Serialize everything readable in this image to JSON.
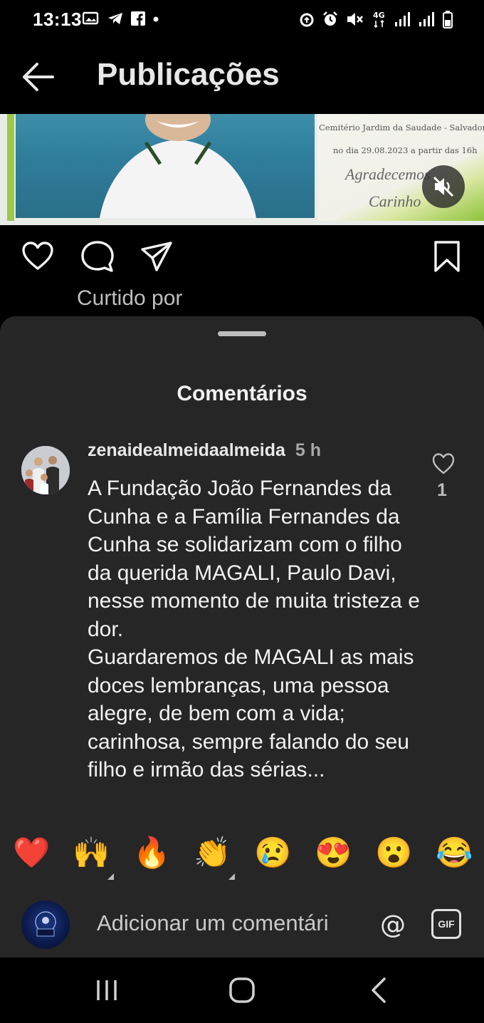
{
  "status_bar": {
    "time": "13:13",
    "left_icons": [
      "image-notification-icon",
      "telegram-icon",
      "facebook-icon",
      "dot-icon"
    ],
    "network_label": "4G",
    "right_icons": [
      "data-saver-icon",
      "alarm-icon",
      "mute-icon",
      "4g-icon",
      "signal-icon",
      "signal-icon",
      "battery-icon"
    ]
  },
  "header": {
    "title": "Publicações",
    "back_icon": "arrow-left-icon"
  },
  "post": {
    "caption_line1": "Cemitério Jardim da Saudade - Salvador",
    "caption_line2": "no dia 29.08.2023 a partir das 16h",
    "caption_line3": "Agradecemos",
    "caption_line4": "Carinho",
    "mute_icon": "speaker-muted-icon"
  },
  "actions": {
    "icons": [
      "heart-icon",
      "comment-icon",
      "share-icon",
      "bookmark-icon"
    ],
    "liked_by": "Curtido por"
  },
  "comments_sheet": {
    "title": "Comentários",
    "comments": [
      {
        "username": "zenaidealmeidaalmeida",
        "time": "5 h",
        "text": "A Fundação João Fernandes da Cunha e a Família Fernandes da Cunha se solidarizam com o filho da querida MAGALI, Paulo Davi, nesse momento de muita tristeza e dor.\nGuardaremos de MAGALI as mais doces lembranças, uma pessoa alegre, de bem com a vida; carinhosa, sempre falando do seu filho e irmão das sérias...",
        "likes": "1"
      }
    ]
  },
  "emoji_bar": [
    "❤️",
    "🙌",
    "🔥",
    "👏",
    "😢",
    "😍",
    "😮",
    "😂"
  ],
  "comment_input": {
    "placeholder": "Adicionar um comentári",
    "at_label": "@",
    "gif_label": "GIF"
  },
  "nav_bar": {
    "icons": [
      "recent-apps-icon",
      "home-icon",
      "back-icon"
    ]
  },
  "colors": {
    "background": "#000000",
    "sheet": "#262626",
    "text": "#f2f2f2",
    "muted_text": "#a8a8a8"
  }
}
